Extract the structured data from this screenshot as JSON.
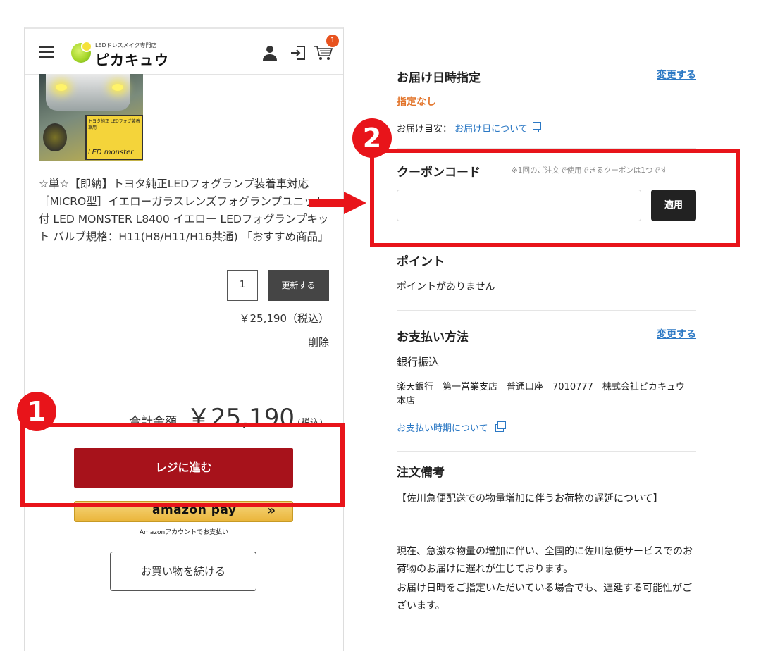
{
  "header": {
    "logo_small": "LEDドレスメイク専門店",
    "logo_main": "ピカキュウ",
    "cart_count": "1"
  },
  "product": {
    "image_label": "トヨタ純正 LEDフォグ装着車用",
    "image_brand": "LED monster",
    "title": "☆単☆【即納】トヨタ純正LEDフォグランプ装着車対応［MICRO型］イエローガラスレンズフォグランプユニット付 LED MONSTER L8400 イエロー LEDフォグランプキット バルブ規格：H11(H8/H11/H16共通) 「おすすめ商品」",
    "quantity": "1",
    "update_label": "更新する",
    "price": "￥25,190（税込）",
    "delete_label": "削除"
  },
  "summary": {
    "total_label": "合計金額",
    "total_amount": "￥25,190",
    "total_tax": "(税込)",
    "checkout_label": "レジに進む",
    "amazon_label": "amazon pay",
    "amazon_arrow": "»",
    "amazon_sub": "Amazonアカウントでお支払い",
    "continue_label": "お買い物を続ける"
  },
  "delivery": {
    "title": "お届け日時指定",
    "change_label": "変更する",
    "value": "指定なし",
    "estimate_prefix": "お届け目安：",
    "estimate_link": "お届け日について"
  },
  "coupon": {
    "title": "クーポンコード",
    "note": "※1回のご注文で使用できるクーポンは1つです",
    "input_value": "",
    "apply_label": "適用"
  },
  "points": {
    "title": "ポイント",
    "value": "ポイントがありません"
  },
  "payment": {
    "title": "お支払い方法",
    "change_label": "変更する",
    "method": "銀行振込",
    "bank_info": "楽天銀行　第一営業支店　普通口座　7010777　株式会社ピカキュウ　本店",
    "timing_link": "お支払い時期について"
  },
  "notes": {
    "title": "注文備考",
    "heading": "【佐川急便配送での物量増加に伴うお荷物の遅延について】",
    "body_1": "現在、急激な物量の増加に伴い、全国的に佐川急便サービスでのお荷物のお届けに遅れが生じております。",
    "body_2": "お届け日時をご指定いただいている場合でも、遅延する可能性がございます。"
  },
  "annotations": {
    "step1": "1",
    "step2": "2",
    "color": "#e8141a"
  },
  "colors": {
    "checkout": "#a7121b",
    "link": "#2b78c4",
    "accent_orange": "#e2742a"
  }
}
